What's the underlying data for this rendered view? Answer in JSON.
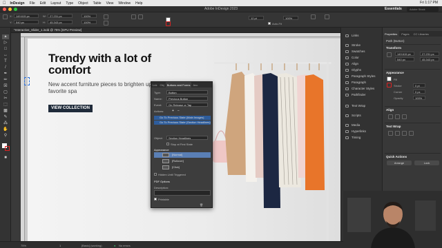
{
  "menubar": {
    "app": "InDesign",
    "items": [
      "File",
      "Edit",
      "Layout",
      "Type",
      "Object",
      "Table",
      "View",
      "Window",
      "Help"
    ],
    "clock": "Fri 1:17 PM"
  },
  "titlebar": {
    "title": "Adobe InDesign 2023",
    "workspace": "Essentials",
    "search_placeholder": "Adobe Stock"
  },
  "controlbar": {
    "x": "149.615 px",
    "y": "540 px",
    "w": "27.231 px",
    "h": "45.343 px",
    "zoom": "100%",
    "stroke_weight": "12 pt",
    "auto_fit": "Auto-Fit",
    "opacity": "100%"
  },
  "document_tab": "*Interactive_Slider_1.indd @ 75% [GPU Preview]",
  "canvas": {
    "headline": "Trendy with a lot of comfort",
    "subline": "New accent furniture pieces to brighten up your favorite spa",
    "cta": "VIEW COLLECTION"
  },
  "buttons_forms": {
    "tabs": [
      "Lnk",
      "Obj",
      "Buttons and Forms",
      "Anc"
    ],
    "type_label": "Type:",
    "type_value": "Button",
    "name_label": "Name:",
    "name_value": "Previous Button",
    "event_label": "Event:",
    "event_value": "On Release or Tap",
    "actions_label": "Actions:",
    "actions": [
      "Go To Previous State (Main Images)",
      "Go To Previous State (Section Headlines)"
    ],
    "object_label": "Object:",
    "object_value": "Section Headlines",
    "stop_first": "Stop at First State",
    "appearance_label": "Appearance",
    "states": [
      "[Normal]",
      "[Rollover]",
      "[Click]"
    ],
    "hidden_until": "Hidden Until Triggered",
    "pdf_options": "PDF Options",
    "description_label": "Description:",
    "printable": "Printable"
  },
  "panel_column": {
    "items": [
      "Links",
      "Stroke",
      "Swatches",
      "Color",
      "Align",
      "Glyphs",
      "Paragraph Styles",
      "Paragraph",
      "Character Styles",
      "Pathfinder",
      "Text Wrap",
      "Scripts",
      "Media",
      "Hyperlinks",
      "Timing"
    ]
  },
  "properties": {
    "tabs": [
      "Properties",
      "Pages",
      "CC Libraries"
    ],
    "object_kind": "Path (Button)",
    "transform": "Transform",
    "x": "149.615 px",
    "y": "540 px",
    "w": "27.231 px",
    "h": "45.343 px",
    "appearance": "Appearance",
    "fill": "Fill",
    "stroke": "Stroke",
    "stroke_weight": "0 pt",
    "corner": "Corner",
    "corner_value": "0 px",
    "opacity": "Opacity",
    "opacity_value": "100%",
    "align": "Align",
    "text_wrap": "Text Wrap",
    "quick_actions": "Quick Actions",
    "arrange": "Arrange",
    "lock": "Lock"
  },
  "statusbar": {
    "zoom": "75%",
    "page": "1",
    "style": "[Basic] (working)",
    "errors": "No errors"
  },
  "colors": {
    "accent_orange": "#e8752a",
    "selection_blue": "#2e5d9c",
    "cta_navy": "#1f2b3a"
  }
}
